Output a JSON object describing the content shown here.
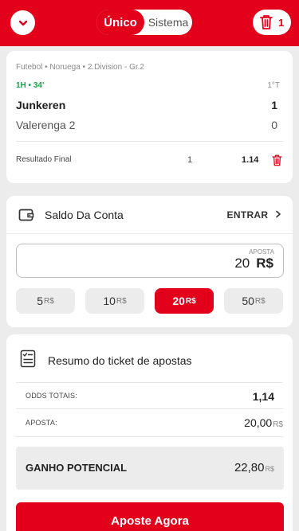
{
  "header": {
    "tabs": [
      "Único",
      "Sistema"
    ],
    "bet_count": "1"
  },
  "selection": {
    "league": "Futebol • Noruega • 2.Division - Gr.2",
    "live_time": "1H • 34'",
    "period": "1°T",
    "home_team": "Junkeren",
    "home_score": "1",
    "away_team": "Valerenga 2",
    "away_score": "0",
    "market": "Resultado Final",
    "pick": "1",
    "odds": "1.14"
  },
  "account": {
    "balance_label": "Saldo Da Conta",
    "login_label": "ENTRAR"
  },
  "stake": {
    "caption": "APOSTA",
    "amount": "20",
    "currency": "R$",
    "quick_amounts": [
      "5",
      "10",
      "20",
      "50"
    ],
    "active_index": 2
  },
  "summary": {
    "title": "Resumo do ticket de apostas",
    "total_odds_label": "ODDS TOTAIS:",
    "total_odds_value": "1,14",
    "stake_label": "APOSTA:",
    "stake_value": "20,00",
    "potential_label": "GANHO POTENCIAL",
    "potential_value": "22,80",
    "currency": "R$",
    "cta": "Aposte Agora"
  },
  "colors": {
    "brand": "#e3001b",
    "live": "#16a34a"
  }
}
